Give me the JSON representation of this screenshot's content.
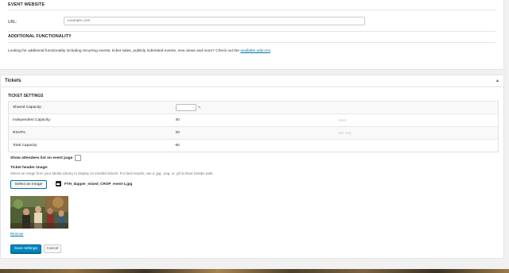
{
  "event_website": {
    "heading": "EVENT WEBSITE",
    "url_label": "URL:",
    "url_placeholder": "example.com"
  },
  "additional": {
    "heading": "ADDITIONAL FUNCTIONALITY",
    "text": "Looking for additional functionality including recurring events, ticket sales, publicly submitted events, new views and more? Check out the",
    "link": "available add-ons",
    "end": "."
  },
  "tickets": {
    "title": "Tickets",
    "toggle_icon": "caret-up-icon",
    "settings_heading": "TICKET SETTINGS",
    "rows": [
      {
        "label": "Shared Capacity:",
        "value": "",
        "note": ""
      },
      {
        "label": "Independent Capacity:",
        "value": "40",
        "note": "ticket"
      },
      {
        "label": "RSVPs:",
        "value": "20",
        "note": "test rsvp"
      },
      {
        "label": "Total Capacity:",
        "value": "60",
        "note": ""
      }
    ],
    "show_attendees_label": "Show attendees list on event page",
    "header_image_label": "Ticket header image:",
    "header_image_desc": "Select an image from your Media Library to display on emailed tickets. For best results, use a .jpg, .png, or .gif at least 1160px wide.",
    "select_image_button": "Select an Image",
    "file_name": "FTH_dapper_mixed_CROP_event-1.jpg",
    "remove_link": "Remove",
    "save_button": "Save settings",
    "cancel_button": "Cancel"
  },
  "colors": {
    "link": "#0073aa",
    "primary_button": "#0085ba"
  }
}
